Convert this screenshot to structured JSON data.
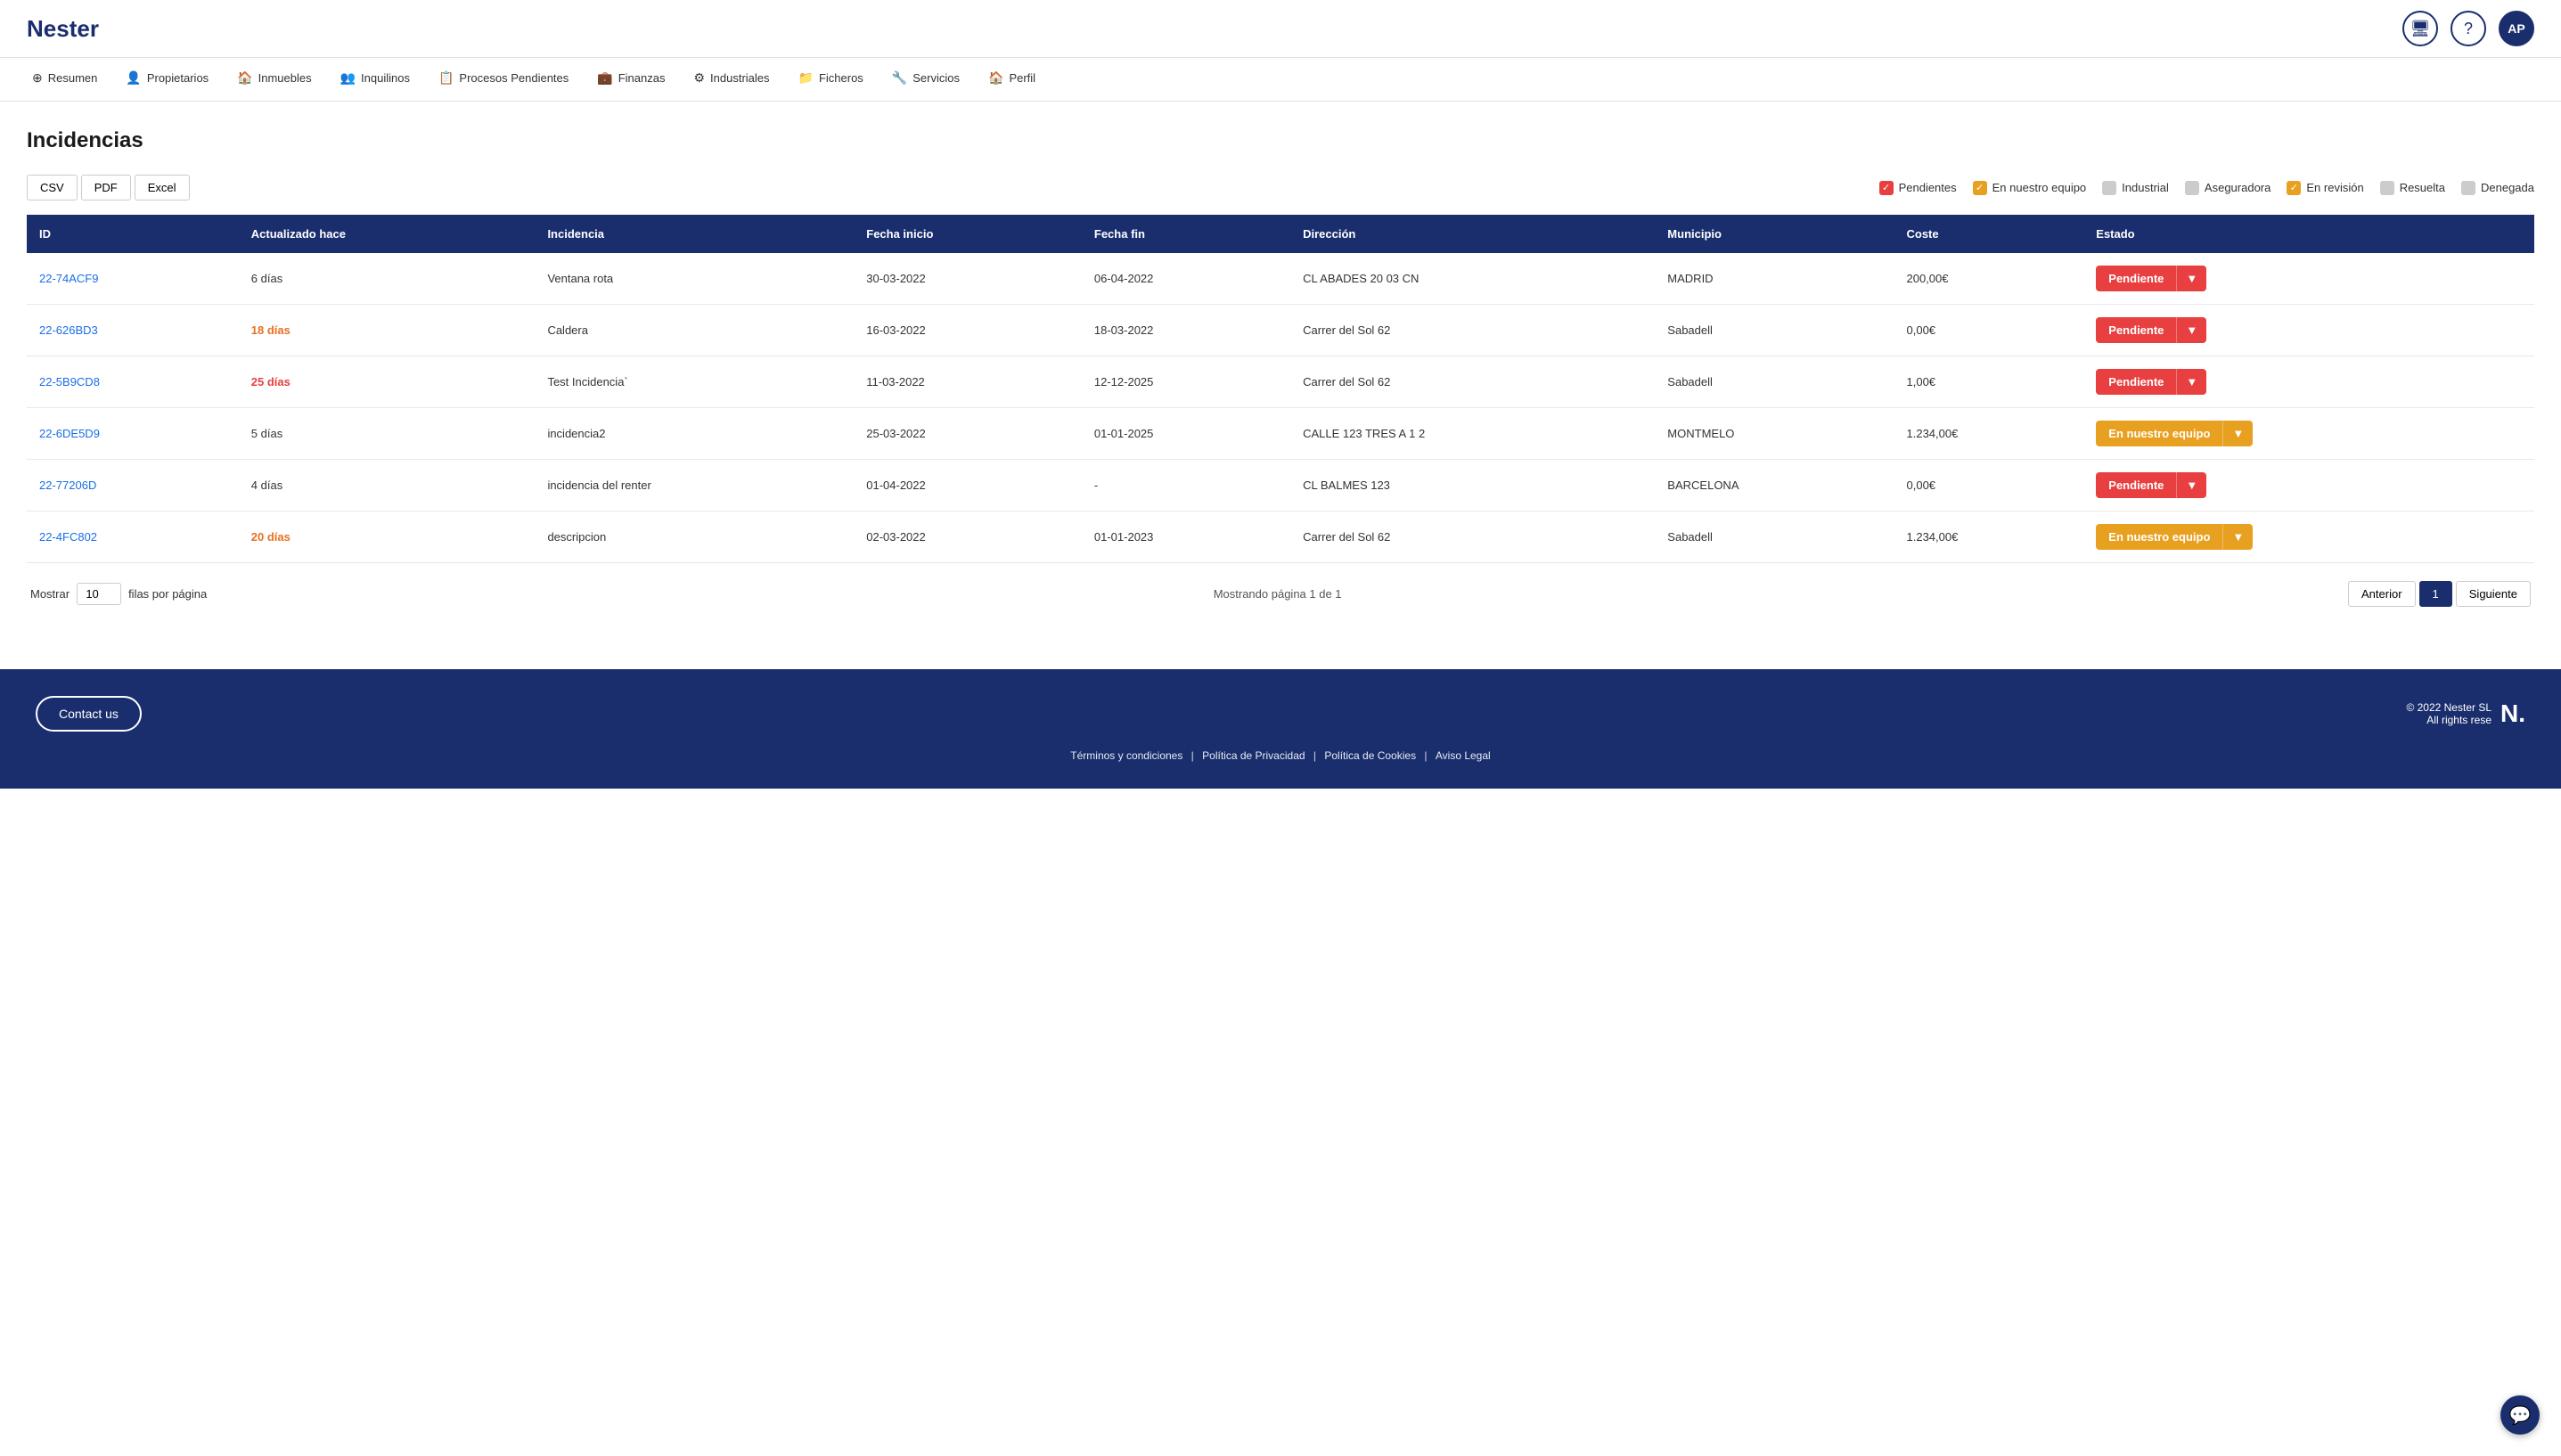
{
  "header": {
    "logo": "Nester",
    "actions": {
      "monitor_icon": "🖥",
      "help_icon": "?",
      "user_initials": "AP"
    }
  },
  "nav": {
    "items": [
      {
        "label": "Resumen",
        "icon": "⊕"
      },
      {
        "label": "Propietarios",
        "icon": "👤"
      },
      {
        "label": "Inmuebles",
        "icon": "🏠"
      },
      {
        "label": "Inquilinos",
        "icon": "👥"
      },
      {
        "label": "Procesos Pendientes",
        "icon": "📋"
      },
      {
        "label": "Finanzas",
        "icon": "💼"
      },
      {
        "label": "Industriales",
        "icon": "⚙"
      },
      {
        "label": "Ficheros",
        "icon": "📁"
      },
      {
        "label": "Servicios",
        "icon": "🔧"
      },
      {
        "label": "Perfil",
        "icon": "🏠"
      }
    ]
  },
  "page": {
    "title": "Incidencias"
  },
  "export_buttons": [
    "CSV",
    "PDF",
    "Excel"
  ],
  "filters": [
    {
      "label": "Pendientes",
      "color": "red",
      "checked": true
    },
    {
      "label": "En nuestro equipo",
      "color": "yellow",
      "checked": true
    },
    {
      "label": "Industrial",
      "color": "gray",
      "checked": false
    },
    {
      "label": "Aseguradora",
      "color": "gray",
      "checked": false
    },
    {
      "label": "En revisión",
      "color": "yellow",
      "checked": true
    },
    {
      "label": "Resuelta",
      "color": "gray",
      "checked": false
    },
    {
      "label": "Denegada",
      "color": "gray",
      "checked": false
    }
  ],
  "table": {
    "headers": [
      "ID",
      "Actualizado hace",
      "Incidencia",
      "Fecha inicio",
      "Fecha fin",
      "Dirección",
      "Municipio",
      "Coste",
      "Estado"
    ],
    "rows": [
      {
        "id": "22-74ACF9",
        "updated": "6 días",
        "updated_color": "normal",
        "incidencia": "Ventana rota",
        "fecha_inicio": "30-03-2022",
        "fecha_fin": "06-04-2022",
        "direccion": "CL ABADES 20 03 CN",
        "municipio": "MADRID",
        "coste": "200,00€",
        "estado": "Pendiente",
        "estado_type": "red"
      },
      {
        "id": "22-626BD3",
        "updated": "18 días",
        "updated_color": "orange",
        "incidencia": "Caldera",
        "fecha_inicio": "16-03-2022",
        "fecha_fin": "18-03-2022",
        "direccion": "Carrer del Sol 62",
        "municipio": "Sabadell",
        "coste": "0,00€",
        "estado": "Pendiente",
        "estado_type": "red"
      },
      {
        "id": "22-5B9CD8",
        "updated": "25 días",
        "updated_color": "red",
        "incidencia": "Test Incidencia`",
        "fecha_inicio": "11-03-2022",
        "fecha_fin": "12-12-2025",
        "direccion": "Carrer del Sol 62",
        "municipio": "Sabadell",
        "coste": "1,00€",
        "estado": "Pendiente",
        "estado_type": "red"
      },
      {
        "id": "22-6DE5D9",
        "updated": "5 días",
        "updated_color": "normal",
        "incidencia": "incidencia2",
        "fecha_inicio": "25-03-2022",
        "fecha_fin": "01-01-2025",
        "direccion": "CALLE 123 TRES A 1 2",
        "municipio": "MONTMELO",
        "coste": "1.234,00€",
        "estado": "En nuestro equipo",
        "estado_type": "yellow"
      },
      {
        "id": "22-77206D",
        "updated": "4 días",
        "updated_color": "normal",
        "incidencia": "incidencia del renter",
        "fecha_inicio": "01-04-2022",
        "fecha_fin": "-",
        "direccion": "CL BALMES 123",
        "municipio": "BARCELONA",
        "coste": "0,00€",
        "estado": "Pendiente",
        "estado_type": "red"
      },
      {
        "id": "22-4FC802",
        "updated": "20 días",
        "updated_color": "orange",
        "incidencia": "descripcion",
        "fecha_inicio": "02-03-2022",
        "fecha_fin": "01-01-2023",
        "direccion": "Carrer del Sol 62",
        "municipio": "Sabadell",
        "coste": "1.234,00€",
        "estado": "En nuestro equipo",
        "estado_type": "yellow"
      }
    ]
  },
  "pagination": {
    "rows_label": "Mostrar",
    "rows_value": "10",
    "rows_suffix": "filas por página",
    "page_info": "Mostrando página 1 de 1",
    "prev_label": "Anterior",
    "page_number": "1",
    "next_label": "Siguiente"
  },
  "footer": {
    "contact_label": "Contact us",
    "brand_logo": "N.",
    "copyright": "© 2022 Nester SL",
    "rights": "All rights rese",
    "links": [
      "Términos y condiciones",
      "Política de Privacidad",
      "Política de Cookies",
      "Aviso Legal"
    ]
  }
}
